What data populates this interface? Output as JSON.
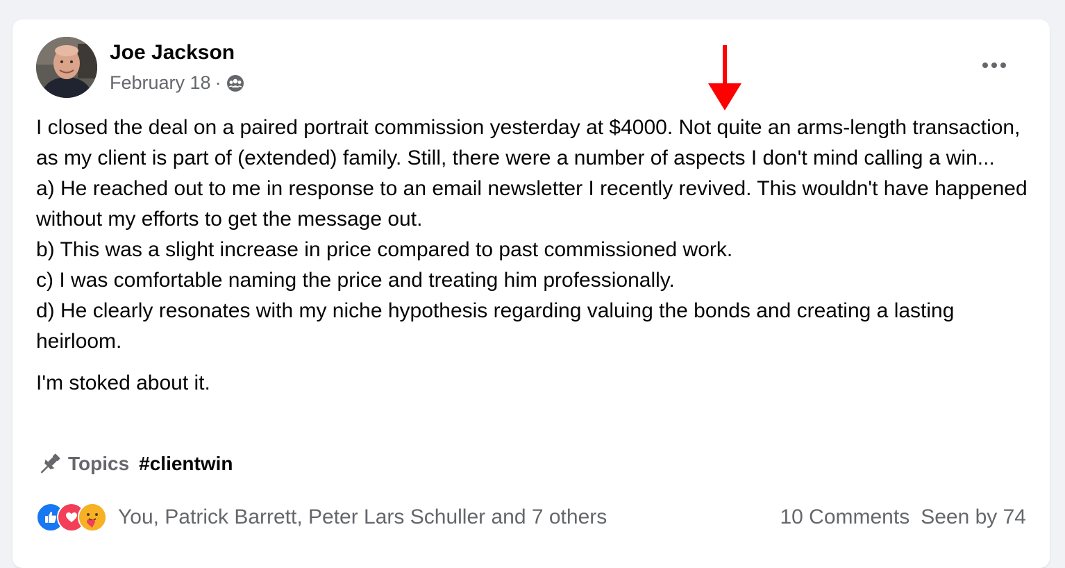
{
  "post": {
    "author": "Joe Jackson",
    "date": "February 18",
    "separator": "·",
    "audience_icon": "group-audience-icon",
    "body_lines": [
      "I closed the deal on a paired portrait commission yesterday at $4000.  Not quite an arms-length transaction, as my client is part of (extended) family.  Still, there were a number of aspects I don't mind calling a win...",
      "a)  He reached out to me in response to an email newsletter I recently revived.  This wouldn't have happened without my efforts to get the message out.",
      "b) This was a slight increase in price compared to past commissioned work.",
      "c) I was comfortable naming the price and treating him professionally.",
      "d)  He clearly resonates with my niche hypothesis regarding valuing the bonds and creating a lasting heirloom."
    ],
    "closing": "I'm stoked about it.",
    "topics_label": "Topics",
    "hashtag": "#clientwin",
    "reactions": {
      "icons": [
        "like-icon",
        "love-icon",
        "care-icon"
      ],
      "names": "You, Patrick Barrett, Peter Lars Schuller and 7 others"
    },
    "comments": "10 Comments",
    "seen_by": "Seen by 74"
  },
  "colors": {
    "like": "#1877f2",
    "love": "#f33e58",
    "care": "#f7b125",
    "annotation_arrow": "#ff0000"
  }
}
